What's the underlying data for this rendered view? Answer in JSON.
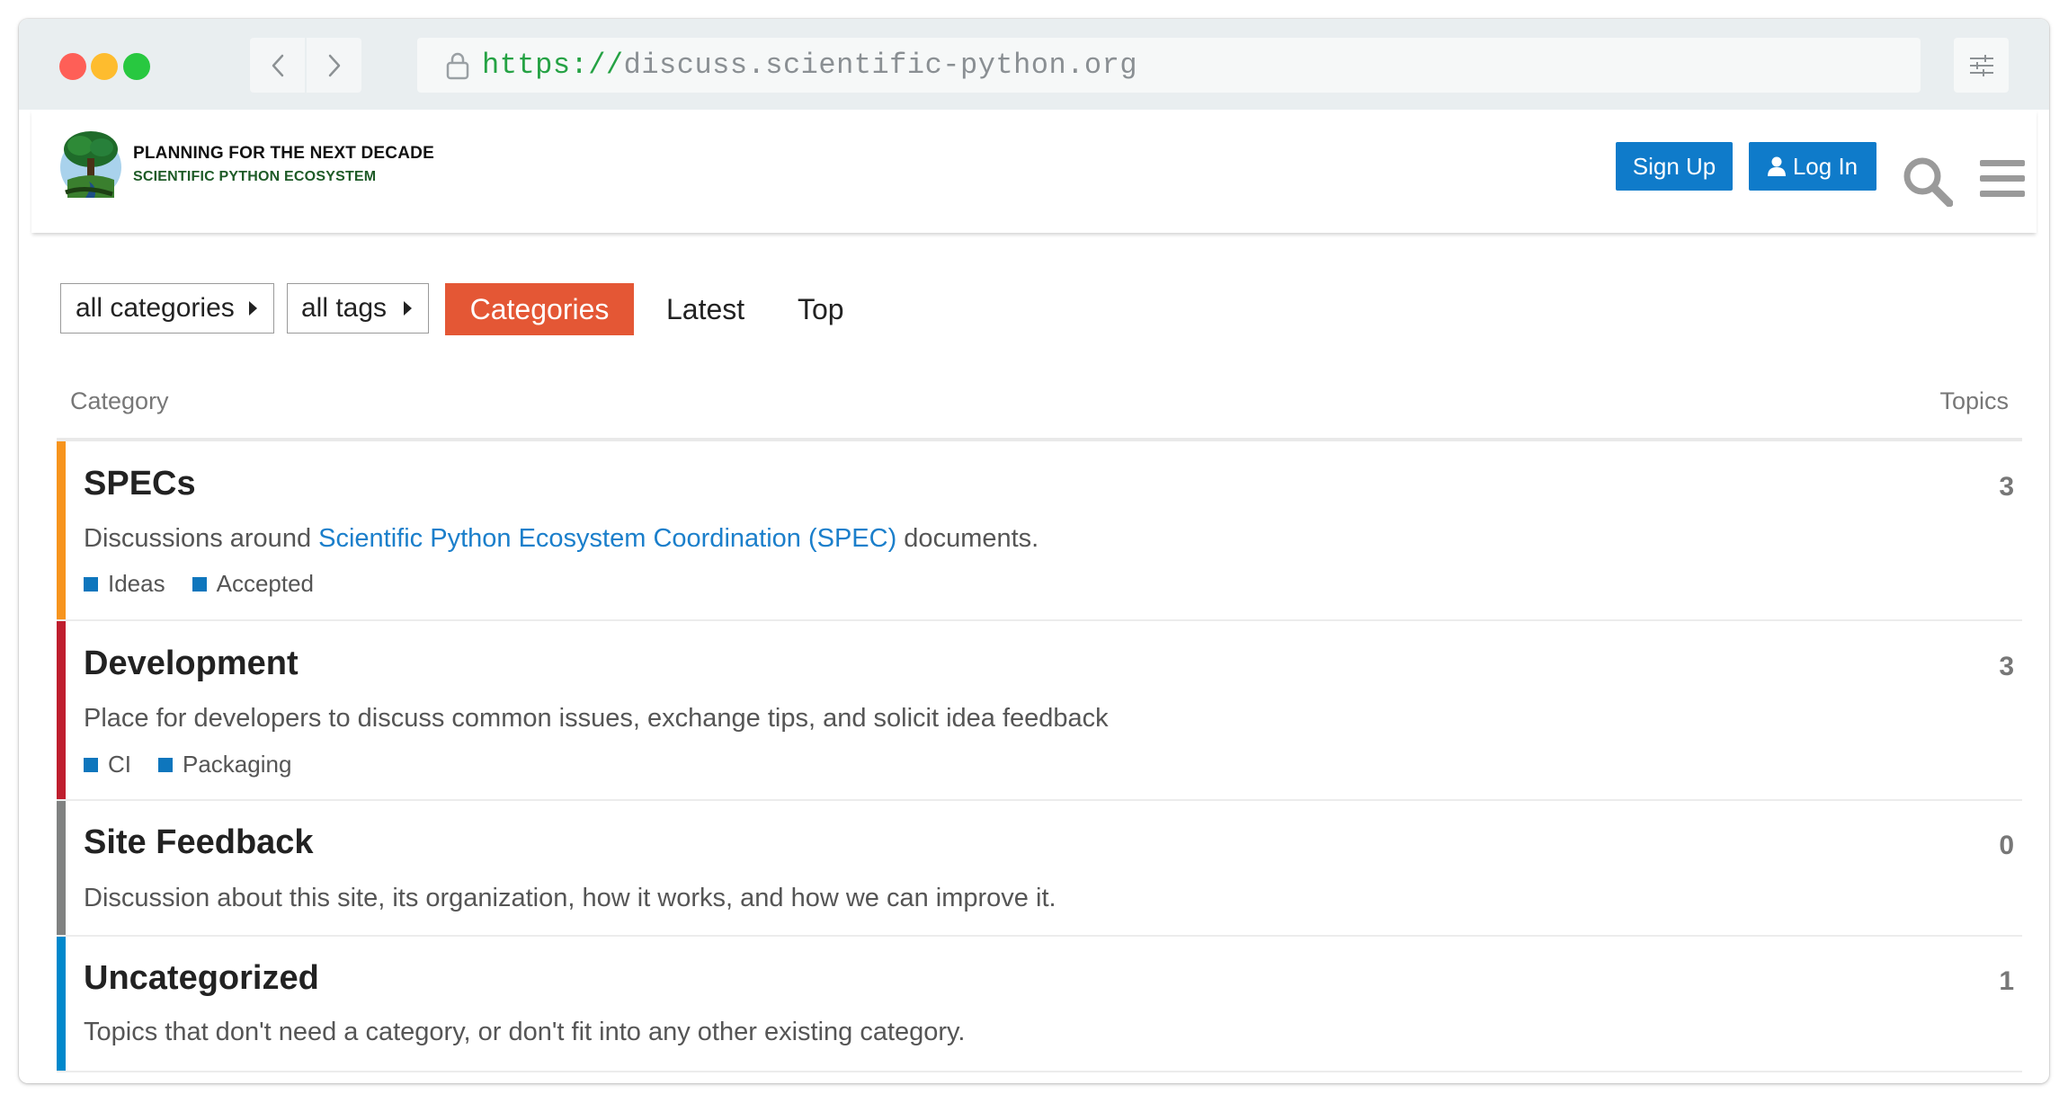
{
  "browser": {
    "url_scheme": "https://",
    "url_host": "discuss.scientific-python.org"
  },
  "header": {
    "brand_title": "PLANNING FOR THE NEXT DECADE",
    "brand_subtitle": "SCIENTIFIC PYTHON ECOSYSTEM",
    "signup_label": "Sign Up",
    "login_label": "Log In"
  },
  "filters": {
    "categories_dropdown": "all categories",
    "tags_dropdown": "all tags",
    "nav_categories": "Categories",
    "nav_latest": "Latest",
    "nav_top": "Top"
  },
  "table": {
    "col_category": "Category",
    "col_topics": "Topics"
  },
  "categories": [
    {
      "name": "SPECs",
      "desc_before": "Discussions around ",
      "desc_link": "Scientific Python Ecosystem Coordination (SPEC)",
      "desc_after": " documents.",
      "topics": "3",
      "color": "#f7941d",
      "subcategories": [
        "Ideas",
        "Accepted"
      ]
    },
    {
      "name": "Development",
      "desc": "Place for developers to discuss common issues, exchange tips, and solicit idea feedback",
      "topics": "3",
      "color": "#bf1e2e",
      "subcategories": [
        "CI",
        "Packaging"
      ]
    },
    {
      "name": "Site Feedback",
      "desc": "Discussion about this site, its organization, how it works, and how we can improve it.",
      "topics": "0",
      "color": "#808281"
    },
    {
      "name": "Uncategorized",
      "desc": "Topics that don't need a category, or don't fit into any other existing category.",
      "topics": "1",
      "color": "#0088cc"
    }
  ],
  "colors": {
    "primary_button": "#0f7bca",
    "active_nav": "#e45735",
    "subcategory_square": "#0e76bd"
  }
}
